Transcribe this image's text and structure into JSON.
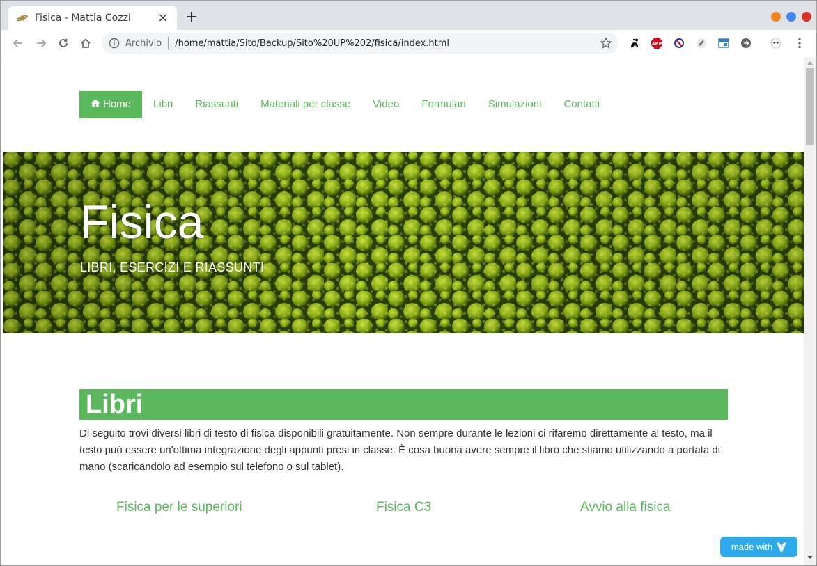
{
  "browser": {
    "tab_title": "Fisica - Mattia Cozzi",
    "secure_label": "Archivio",
    "url": "/home/mattia/Sito/Backup/Sito%20UP%202/fisica/index.html",
    "window_controls": [
      {
        "name": "minimize",
        "color": "#f4831f"
      },
      {
        "name": "maximize",
        "color": "#4285f4"
      },
      {
        "name": "close",
        "color": "#d93025"
      }
    ],
    "extensions": [
      "gnome-icon",
      "abp-icon",
      "block-icon",
      "pen-icon",
      "window-icon",
      "arrow-right-circle-icon",
      "alien-icon",
      "menu-kebab-icon"
    ]
  },
  "site": {
    "accent_color": "#5cb85c",
    "nav": [
      {
        "label": "Home",
        "active": true,
        "icon": "home-icon"
      },
      {
        "label": "Libri"
      },
      {
        "label": "Riassunti"
      },
      {
        "label": "Materiali per classe"
      },
      {
        "label": "Video"
      },
      {
        "label": "Formulari"
      },
      {
        "label": "Simulazioni"
      },
      {
        "label": "Contatti"
      }
    ],
    "hero": {
      "title": "Fisica",
      "subtitle": "LIBRI, ESERCIZI E RIASSUNTI"
    },
    "section": {
      "title": "Libri",
      "text": "Di seguito trovi diversi libri di testo di fisica disponibili gratuitamente. Non sempre durante le lezioni ci rifaremo direttamente al testo, ma il testo può essere un'ottima integrazione degli appunti presi in classe. È cosa buona avere sempre il libro che stiamo utilizzando a portata di mano (scaricandolo ad esempio sul telefono o sul tablet)."
    },
    "books": [
      "Fisica per le superiori",
      "Fisica C3",
      "Avvio alla fisica"
    ],
    "badge": {
      "label": "made with",
      "color": "#2ea9e9"
    }
  }
}
